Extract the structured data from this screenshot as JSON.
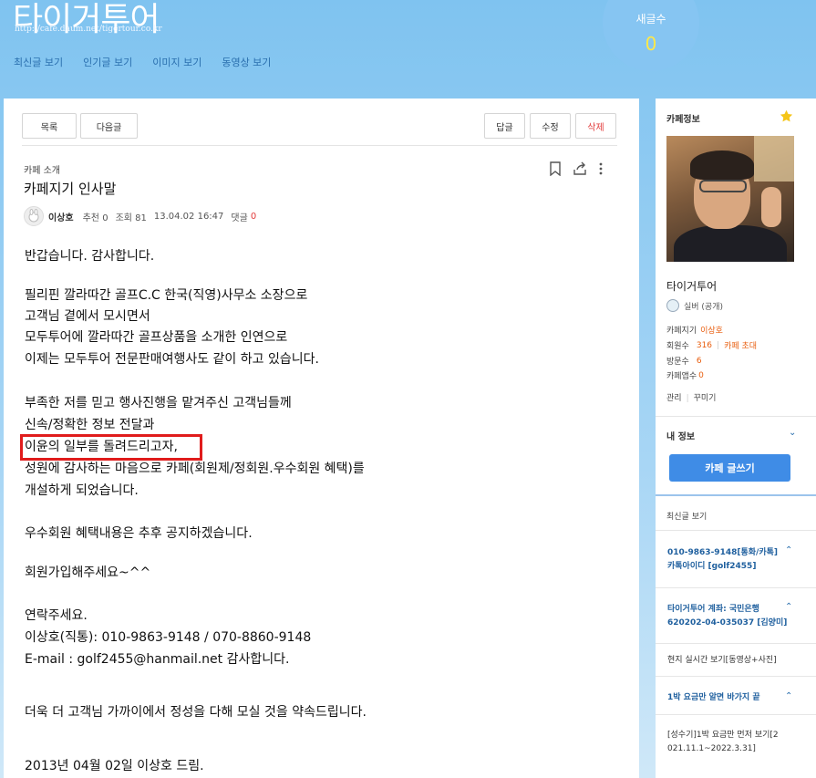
{
  "header": {
    "cafe_title": "타이거투어",
    "cafe_url": "http://cafe.daum.net/tigertour.co.kr",
    "nav": [
      "최신글 보기",
      "인기글 보기",
      "이미지 보기",
      "동영상 보기"
    ],
    "new_posts_label": "새글수",
    "new_posts_count": "0"
  },
  "toolbar": {
    "list": "목록",
    "next": "다음글",
    "reply": "답글",
    "edit": "수정",
    "delete": "삭제"
  },
  "post": {
    "category": "카페 소개",
    "title": "카페지기 인사말",
    "author": "이상호",
    "recommend": "추천 0",
    "views": "조회 81",
    "date": "13.04.02 16:47",
    "comments_label": "댓글",
    "comments_count": "0",
    "lines": [
      "반갑습니다. 감사합니다.",
      "필리핀 깔라따간 골프C.C 한국(직영)사무소 소장으로",
      "고객님 곁에서 모시면서",
      "모두투어에 깔라따간 골프상품을 소개한 인연으로",
      "이제는 모두투어 전문판매여행사도 같이 하고 있습니다.",
      "부족한 저를 믿고 행사진행을 맡겨주신 고객님들께",
      "신속/정확한 정보 전달과",
      "이윤의 일부를 돌려드리고자,",
      "성원에 감사하는 마음으로 카페(회원제/정회원.우수회원 혜택)를",
      "개설하게 되었습니다.",
      "우수회원 혜택내용은 추후 공지하겠습니다.",
      "회원가입해주세요~^^",
      "연락주세요.",
      "이상호(직통): 010-9863-9148 / 070-8860-9148",
      "E-mail : golf2455@hanmail.net 감사합니다.",
      "더욱 더 고객님 가까이에서 정성을 다해 모실 것을 약속드립니다.",
      "2013년 04월 02일 이상호 드림."
    ]
  },
  "sidebar": {
    "title": "카페정보",
    "cafe_name": "타이거투어",
    "grade": "실버 (공개)",
    "manager_label": "카페지기",
    "manager_name": "이상호",
    "members_label": "회원수",
    "members_count": "316",
    "invite": "카페 초대",
    "visits_label": "방문수",
    "visits_count": "6",
    "apps_label": "카페앱수",
    "apps_count": "0",
    "manage": "관리",
    "decorate": "꾸미기",
    "my_info": "내 정보",
    "write_button": "카페 글쓰기",
    "recent_title": "최신글 보기",
    "notices": [
      {
        "l1": "010-9863-9148[통화/카톡]",
        "l2": "카톡아이디 [golf2455]"
      },
      {
        "l1": "타이거투어 계좌: 국민은행",
        "l2": "620202-04-035037 [김양미]"
      },
      {
        "l1": "현지 실시간 보기[동영상+사진]"
      },
      {
        "l1": "1박 요금만 알면 바가지 끝"
      },
      {
        "l1": "[성수기]1박 요금만 먼저 보기[2",
        "l2": "021.11.1~2022.3.31]"
      }
    ]
  },
  "colors": {
    "accent_blue": "#3f8ce6",
    "highlight_red": "#e01c1c",
    "link_orange": "#e85c0c"
  }
}
